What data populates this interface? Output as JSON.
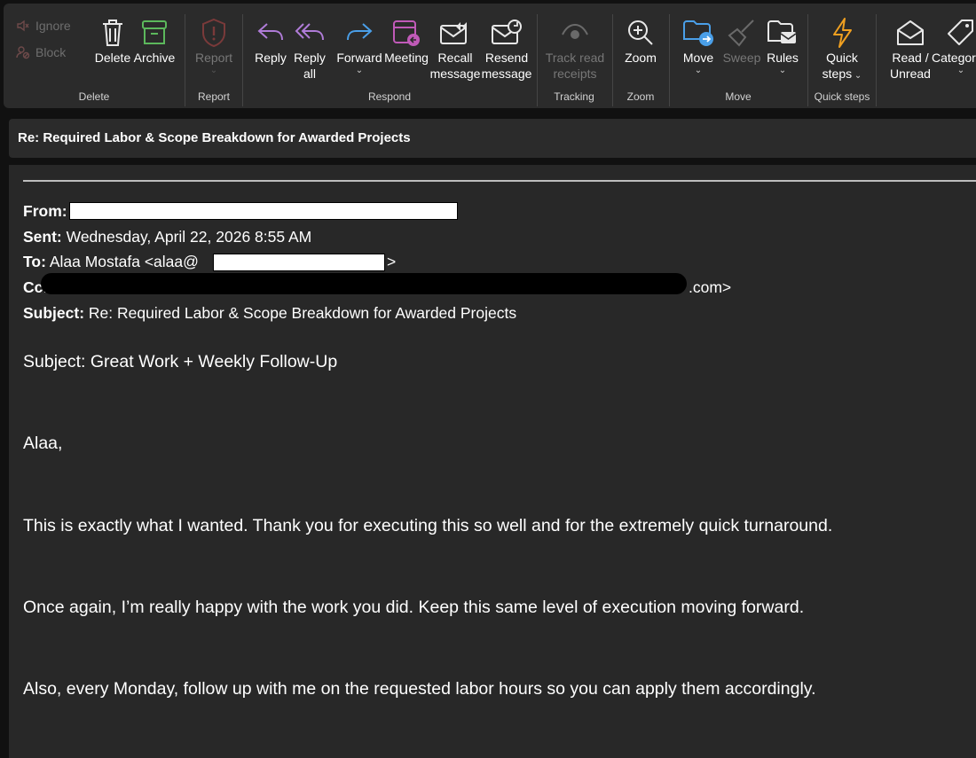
{
  "ribbon": {
    "ignore_label": "Ignore",
    "block_label": "Block",
    "delete_label": "Delete",
    "archive_label": "Archive",
    "delete_group": "Delete",
    "report_label": "Report",
    "report_group": "Report",
    "reply_label": "Reply",
    "reply_all_line1": "Reply",
    "reply_all_line2": "all",
    "forward_label": "Forward",
    "meeting_label": "Meeting",
    "recall_line1": "Recall",
    "recall_line2": "message",
    "resend_line1": "Resend",
    "resend_line2": "message",
    "respond_group": "Respond",
    "track_line1": "Track read",
    "track_line2": "receipts",
    "tracking_group": "Tracking",
    "zoom_label": "Zoom",
    "zoom_group": "Zoom",
    "move_label": "Move",
    "sweep_label": "Sweep",
    "rules_label": "Rules",
    "move_group": "Move",
    "quick_line1": "Quick",
    "quick_line2": "steps",
    "quick_group": "Quick steps",
    "read_line1": "Read /",
    "read_line2": "Unread",
    "categorize_label": "Categorize"
  },
  "message": {
    "subject_bar": "Re: Required Labor & Scope Breakdown for Awarded Projects",
    "from_label": "From:",
    "sent_label": "Sent:",
    "sent_value": "Wednesday, April 22, 2026 8:55 AM",
    "to_label": "To:",
    "to_value": "Alaa Mostafa <alaa@",
    "to_suffix": ">",
    "cc_label": "Cc:",
    "cc_suffix": ".com>",
    "subject_label": "Subject:",
    "subject_value": "Re: Required Labor & Scope Breakdown for Awarded Projects",
    "body": [
      "Subject: Great Work + Weekly Follow-Up",
      "Alaa,",
      "This is exactly what I wanted. Thank you for executing this so well and for the extremely quick turnaround.",
      "Once again, I’m really happy with the work you did. Keep this same level of execution moving forward.",
      "Also, every Monday, follow up with me on the requested labor hours so you can apply them accordingly."
    ]
  }
}
